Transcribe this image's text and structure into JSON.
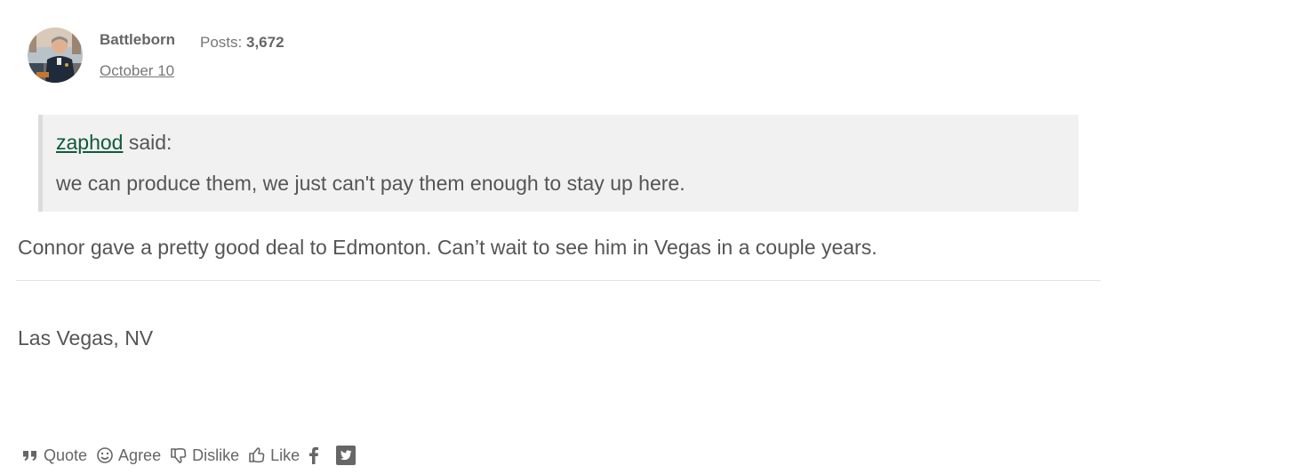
{
  "post": {
    "author": {
      "name": "Battleborn",
      "posts_label": "Posts:",
      "posts_count": "3,672"
    },
    "date": "October 10",
    "quote": {
      "author": "zaphod",
      "said_label": "said:",
      "text": "we can produce them, we just can't pay them enough to stay up here."
    },
    "body": "Connor gave a pretty good deal to Edmonton. Can’t wait to see him in Vegas in a couple years.",
    "signature": "Las Vegas, NV",
    "actions": {
      "quote": "Quote",
      "agree": "Agree",
      "dislike": "Dislike",
      "like": "Like"
    },
    "icons": {
      "quote": "quote-icon",
      "agree": "smiley-icon",
      "dislike": "thumbs-down-icon",
      "like": "thumbs-up-icon",
      "facebook": "facebook-icon",
      "twitter": "twitter-icon"
    },
    "colors": {
      "link": "#0f5a3a",
      "quote_background": "#f1f1f1",
      "text": "#555555"
    }
  }
}
